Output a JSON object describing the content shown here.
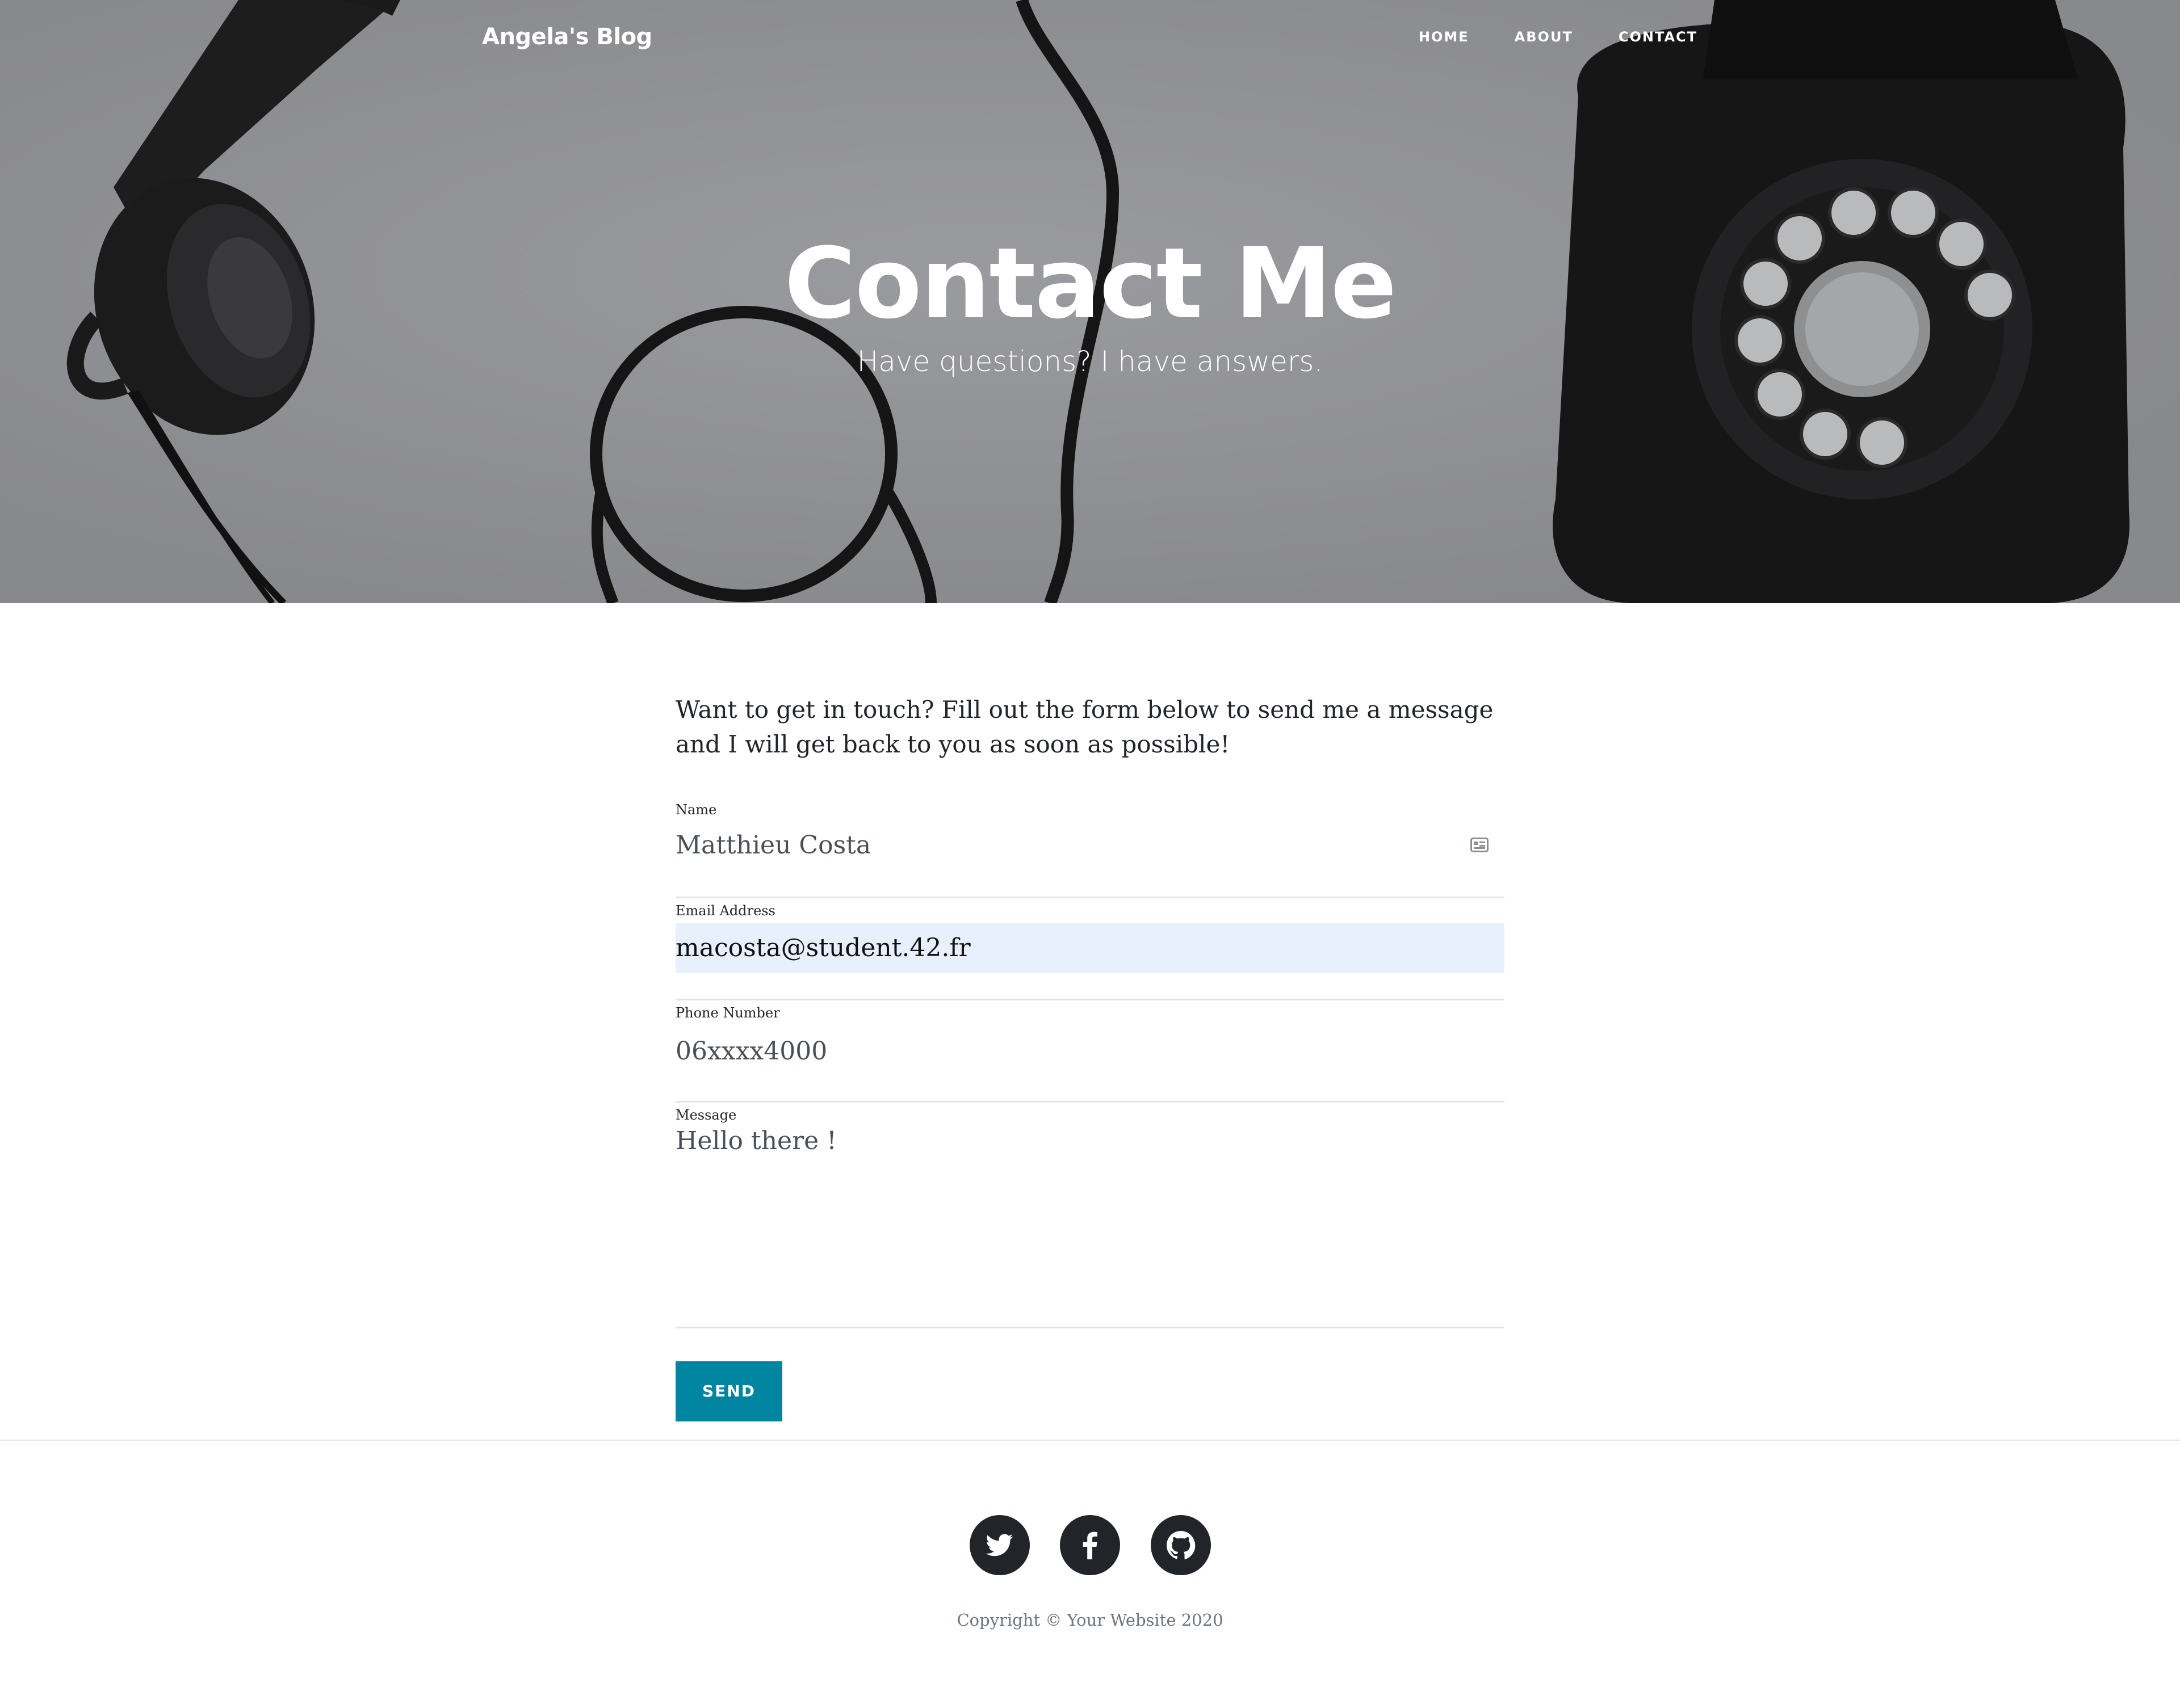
{
  "nav": {
    "brand": "Angela's Blog",
    "links": [
      "HOME",
      "ABOUT",
      "CONTACT"
    ]
  },
  "hero": {
    "title": "Contact Me",
    "subtitle": "Have questions? I have answers."
  },
  "intro": "Want to get in touch? Fill out the form below to send me a message and I will get back to you as soon as possible!",
  "form": {
    "name": {
      "label": "Name",
      "value": "Matthieu Costa"
    },
    "email": {
      "label": "Email Address",
      "value": "macosta@student.42.fr"
    },
    "phone": {
      "label": "Phone Number",
      "value": "06xxxx4000"
    },
    "message": {
      "label": "Message",
      "value": "Hello there !"
    },
    "send_label": "SEND"
  },
  "footer": {
    "social": [
      "twitter-icon",
      "facebook-icon",
      "github-icon"
    ],
    "copyright": "Copyright © Your Website 2020"
  },
  "colors": {
    "accent": "#0085a1",
    "autofill": "#e8f0fe",
    "footer_icon": "#212529"
  }
}
